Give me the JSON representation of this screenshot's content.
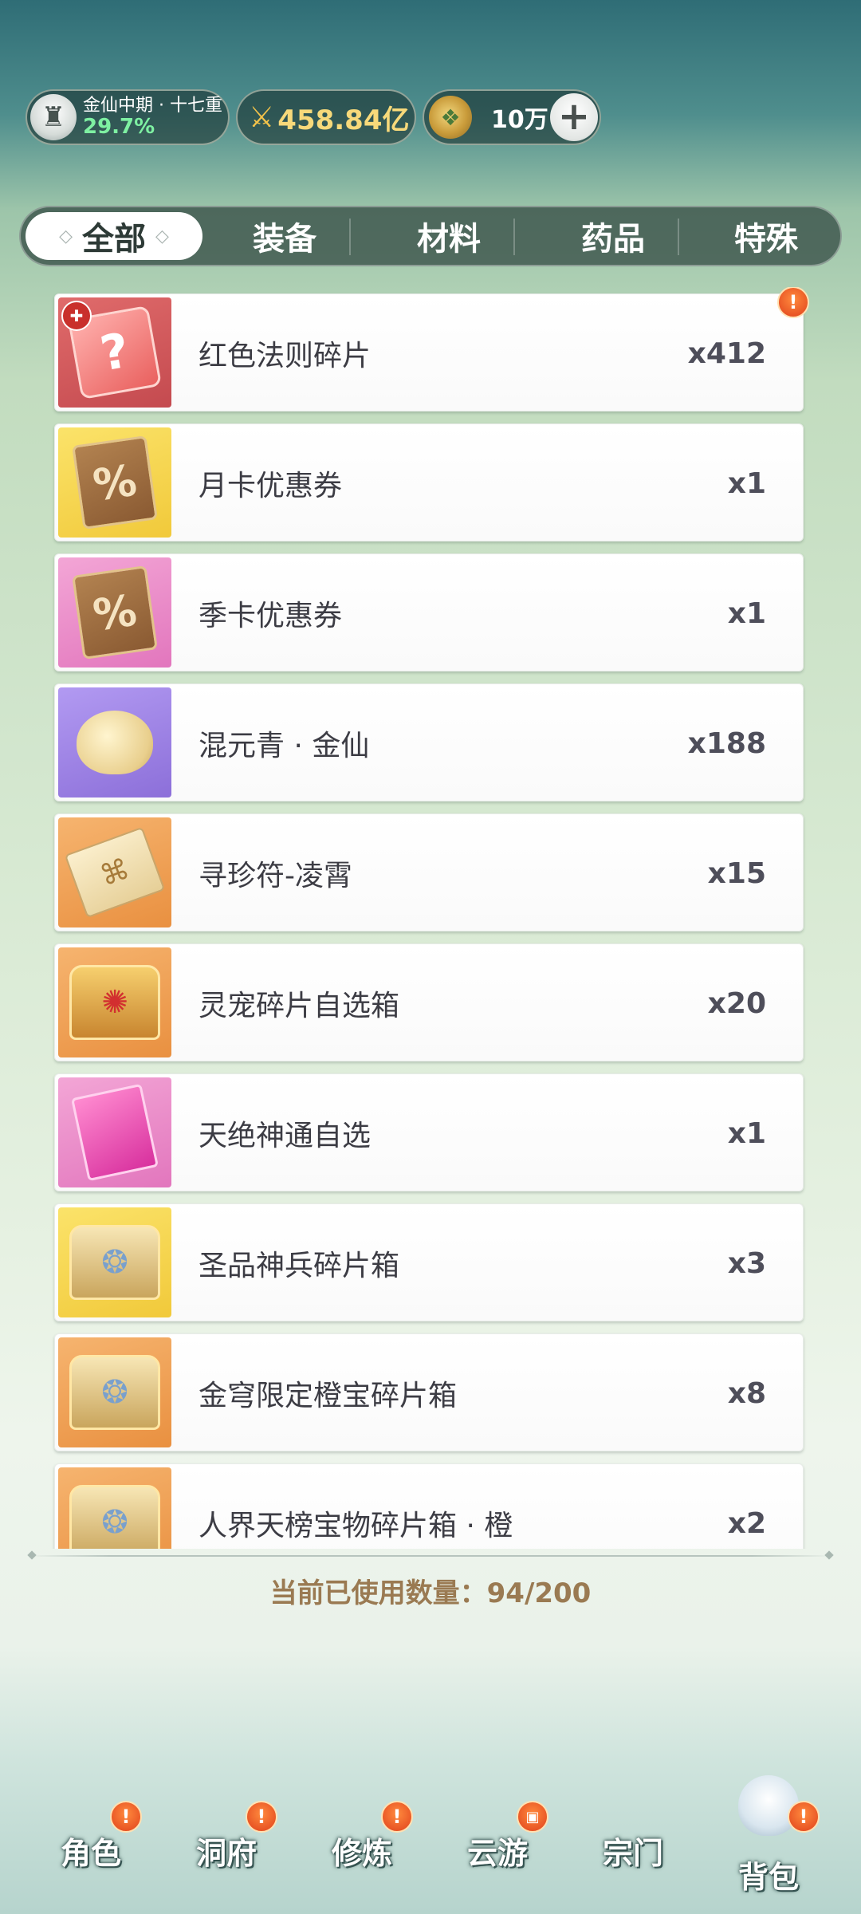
{
  "header": {
    "realm": {
      "name": "金仙中期 · 十七重",
      "progress": "29.7%"
    },
    "power": {
      "value": "458.84亿"
    },
    "currency": {
      "value": "10万",
      "add_icon": "+"
    }
  },
  "tabs": [
    {
      "label": "全部",
      "active": true
    },
    {
      "label": "装备",
      "active": false
    },
    {
      "label": "材料",
      "active": false
    },
    {
      "label": "药品",
      "active": false
    },
    {
      "label": "特殊",
      "active": false
    }
  ],
  "items": [
    {
      "name": "红色法则碎片",
      "qty": "x412",
      "icon": "puzzle-fragment-icon",
      "bg": "red",
      "badge": "!"
    },
    {
      "name": "月卡优惠券",
      "qty": "x1",
      "icon": "coupon-icon",
      "bg": "yellow"
    },
    {
      "name": "季卡优惠券",
      "qty": "x1",
      "icon": "coupon-icon",
      "bg": "pink"
    },
    {
      "name": "混元青 · 金仙",
      "qty": "x188",
      "icon": "herb-icon",
      "bg": "purple"
    },
    {
      "name": "寻珍符-凌霄",
      "qty": "x15",
      "icon": "talisman-icon",
      "bg": "orange"
    },
    {
      "name": "灵宠碎片自选箱",
      "qty": "x20",
      "icon": "treasure-chest-icon",
      "bg": "orange"
    },
    {
      "name": "天绝神通自选",
      "qty": "x1",
      "icon": "book-icon",
      "bg": "pink"
    },
    {
      "name": "圣品神兵碎片箱",
      "qty": "x3",
      "icon": "treasure-chest-icon",
      "bg": "yellow"
    },
    {
      "name": "金穹限定橙宝碎片箱",
      "qty": "x8",
      "icon": "treasure-chest-icon",
      "bg": "orange"
    },
    {
      "name": "人界天榜宝物碎片箱 · 橙",
      "qty": "x2",
      "icon": "treasure-chest-icon",
      "bg": "orange"
    }
  ],
  "usage": "当前已使用数量：94/200",
  "nav": [
    {
      "label": "角色",
      "badge": "!"
    },
    {
      "label": "洞府",
      "badge": "!"
    },
    {
      "label": "修炼",
      "badge": "!"
    },
    {
      "label": "云游",
      "badge": "chest"
    },
    {
      "label": "宗门"
    },
    {
      "label": "背包",
      "badge": "!",
      "active": true
    }
  ],
  "colors": {
    "accent_gold": "#f7d97a",
    "progress_green": "#7ef0a2",
    "usage_text": "#9a7a52",
    "alert_badge": "#e0411c"
  }
}
